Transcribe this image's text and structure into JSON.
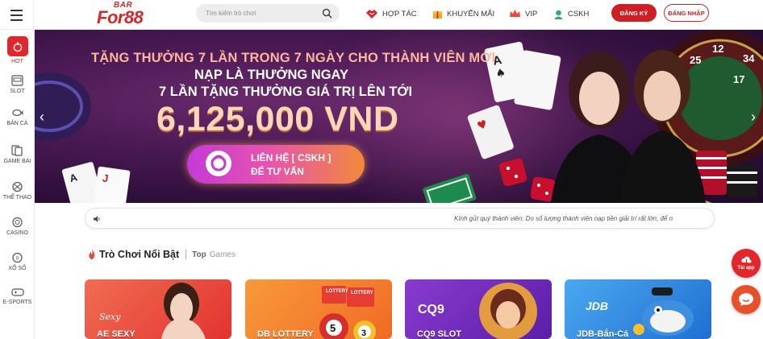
{
  "header": {
    "logo_top": "BAR",
    "logo_main": "For88",
    "search_placeholder": "Tìm kiếm trò chơi",
    "nav": [
      {
        "label": "HỢP TÁC",
        "icon": "handshake-icon"
      },
      {
        "label": "KHUYẾN MÃI",
        "icon": "gift-icon"
      },
      {
        "label": "VIP",
        "icon": "crown-icon"
      },
      {
        "label": "CSKH",
        "icon": "support-agent-icon"
      }
    ],
    "register_label": "ĐĂNG KÝ",
    "login_label": "ĐĂNG NHẬP"
  },
  "sidebar": {
    "items": [
      {
        "label": "HOT",
        "icon": "hot-fire-icon",
        "active": true
      },
      {
        "label": "SLOT",
        "icon": "slot-machine-icon"
      },
      {
        "label": "BẮN CÁ",
        "icon": "fish-icon"
      },
      {
        "label": "GAME BÀI",
        "icon": "cards-icon"
      },
      {
        "label": "THỂ THAO",
        "icon": "sports-icon"
      },
      {
        "label": "CASINO",
        "icon": "casino-chip-icon"
      },
      {
        "label": "XỔ SỐ",
        "icon": "lottery-ball-icon"
      },
      {
        "label": "E-SPORTS",
        "icon": "gamepad-icon"
      }
    ]
  },
  "banner": {
    "line1": "TẶNG THƯỞNG 7 LẦN TRONG 7 NGÀY CHO THÀNH VIÊN MỚI",
    "line2": "NẠP LÀ THƯỞNG NGAY",
    "line3": "7 LẦN TẶNG THƯỞNG GIÁ TRỊ LÊN TỚI",
    "amount": "6,125,000 VND",
    "cta_line1": "LIÊN HỆ [ CSKH ]",
    "cta_line2": "ĐỂ TƯ VẤN"
  },
  "notice": {
    "message": "Kính gửi quý thành viên: Do số lượng thành viên nạp tiền giải trí rất lớn, để n"
  },
  "section": {
    "title": "Trò Chơi Nổi Bật",
    "sub1": "Top",
    "sub2": "Games"
  },
  "games": [
    {
      "name": "AE SEXY",
      "color": "#e8453c"
    },
    {
      "name": "DB LOTTERY",
      "color": "#f07a2a"
    },
    {
      "name": "CQ9 SLOT",
      "color": "#7a2bbd"
    },
    {
      "name": "JDB-Bắn-Cá",
      "color": "#2f8ee6"
    }
  ],
  "floating": {
    "app_label": "Tải app"
  },
  "colors": {
    "brand_red": "#d6272a",
    "banner_bg": "#3a1448"
  }
}
